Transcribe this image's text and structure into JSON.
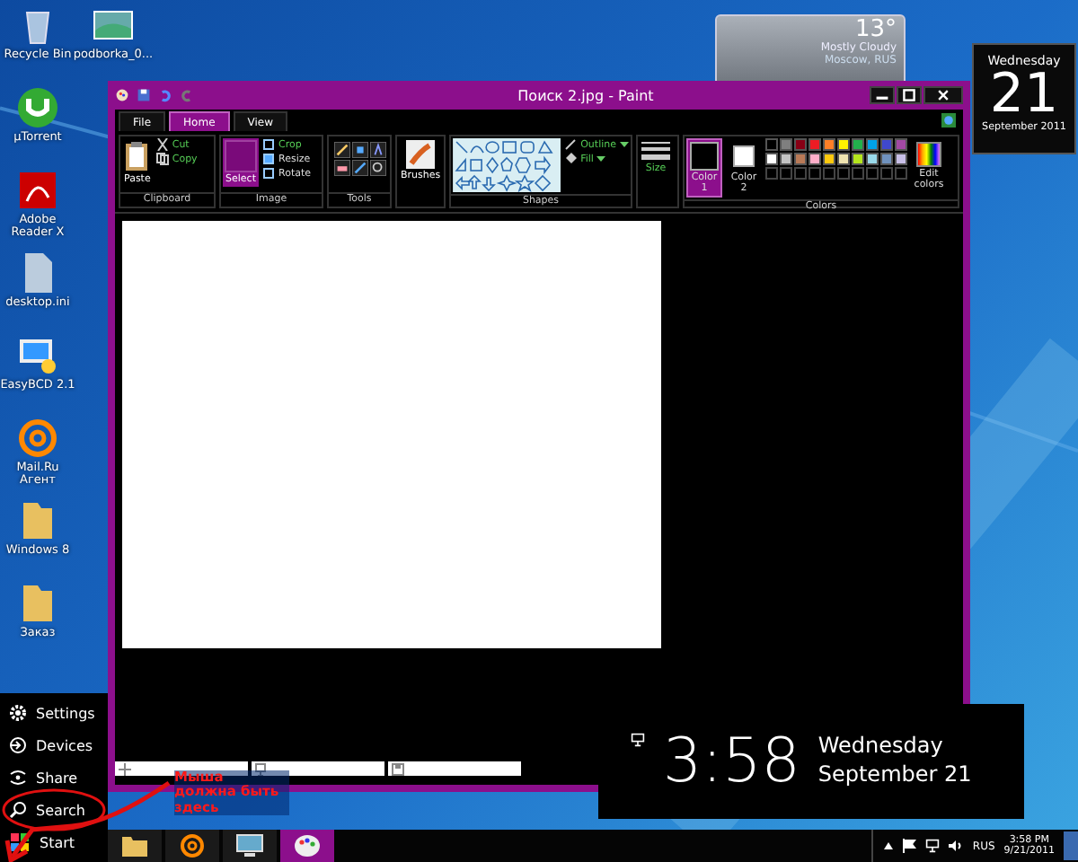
{
  "desktop_icons": [
    {
      "label": "Recycle Bin",
      "kind": "bin"
    },
    {
      "label": "podborka_0...",
      "kind": "photo"
    },
    {
      "label": "µTorrent",
      "kind": "torrent"
    },
    {
      "label": "Adobe Reader X",
      "kind": "pdf"
    },
    {
      "label": "desktop.ini",
      "kind": "file"
    },
    {
      "label": "EasyBCD 2.1",
      "kind": "pc"
    },
    {
      "label": "Mail.Ru Агент",
      "kind": "mail"
    },
    {
      "label": "Windows 8",
      "kind": "folder"
    },
    {
      "label": "Заказ",
      "kind": "folder"
    }
  ],
  "weather_gadget": {
    "temperature": "13°",
    "condition": "Mostly Cloudy",
    "location": "Moscow, RUS"
  },
  "calendar_gadget": {
    "day": "Wednesday",
    "date": "21",
    "month": "September 2011"
  },
  "paint": {
    "title": "Поиск 2.jpg - Paint",
    "tabs": [
      {
        "label": "File",
        "selected": false
      },
      {
        "label": "Home",
        "selected": true
      },
      {
        "label": "View",
        "selected": false
      }
    ],
    "groups": [
      {
        "kind": "clipboard",
        "label": "Clipboard",
        "big": "Paste",
        "small": [
          "Cut",
          "Copy"
        ]
      },
      {
        "kind": "image",
        "label": "Image",
        "big": "Select",
        "small": [
          "Crop",
          "Resize",
          "Rotate"
        ]
      },
      {
        "kind": "tools",
        "label": "Tools"
      },
      {
        "kind": "brushes",
        "big": "Brushes"
      },
      {
        "kind": "shapes",
        "label": "Shapes",
        "small": [
          "Outline",
          "Fill"
        ]
      },
      {
        "kind": "size",
        "big": "Size"
      },
      {
        "kind": "colors",
        "label": "Colors",
        "color1": {
          "label": "Color 1",
          "selected": true
        },
        "color2": {
          "label": "Color 2",
          "selected": false
        },
        "swatches": [
          {
            "color": "#000000"
          },
          {
            "color": "#7f7f7f"
          },
          {
            "color": "#880015"
          },
          {
            "color": "#ed1c24"
          },
          {
            "color": "#ff7f27"
          },
          {
            "color": "#fff200"
          },
          {
            "color": "#22b14c"
          },
          {
            "color": "#00a2e8"
          },
          {
            "color": "#3f48cc"
          },
          {
            "color": "#a349a4"
          },
          {
            "color": "#ffffff"
          },
          {
            "color": "#c3c3c3"
          },
          {
            "color": "#b97a57"
          },
          {
            "color": "#ffaec9"
          },
          {
            "color": "#ffc90e"
          },
          {
            "color": "#efe4b0"
          },
          {
            "color": "#b5e61d"
          },
          {
            "color": "#99d9ea"
          },
          {
            "color": "#7092be"
          },
          {
            "color": "#c8bfe7"
          }
        ],
        "edit": "Edit colors"
      }
    ]
  },
  "charms": [
    {
      "label": "Settings",
      "kind": "settings"
    },
    {
      "label": "Devices",
      "kind": "devices"
    },
    {
      "label": "Share",
      "kind": "share"
    },
    {
      "label": "Search",
      "kind": "search"
    },
    {
      "label": "Start",
      "kind": "start"
    }
  ],
  "annotation": {
    "text": "Мыша должна быть здесь"
  },
  "clock_overlay": {
    "time": "3:58",
    "day": "Wednesday",
    "date": "September 21"
  },
  "taskbar": {
    "apps": [
      {
        "kind": "explorer",
        "selected": false
      },
      {
        "kind": "mail",
        "selected": false
      },
      {
        "kind": "monitor",
        "selected": false
      },
      {
        "kind": "paint",
        "selected": true
      }
    ],
    "language": "RUS",
    "time": "3:58 PM",
    "date": "9/21/2011"
  }
}
